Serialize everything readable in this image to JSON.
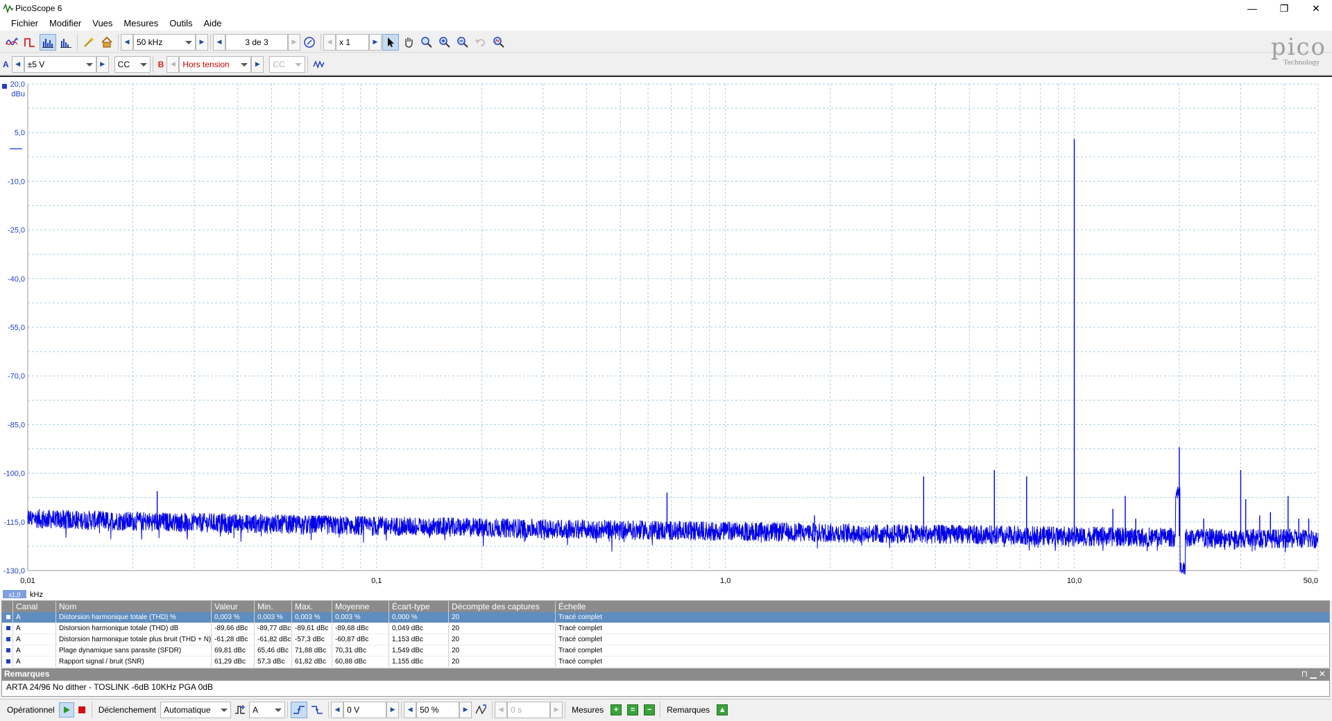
{
  "window": {
    "title": "PicoScope 6",
    "minimize": "—",
    "restore": "❐",
    "close": "✕"
  },
  "menu": [
    "Fichier",
    "Modifier",
    "Vues",
    "Mesures",
    "Outils",
    "Aide"
  ],
  "toolbar1": {
    "frequency": "50 kHz",
    "buffer": "3 de 3",
    "zoom": "x 1"
  },
  "toolbar2": {
    "chan_a": "A",
    "range_a": "±5 V",
    "coupling_a": "CC",
    "chan_b": "B",
    "range_b": "Hors tension",
    "coupling_b": "CC"
  },
  "logo": {
    "word": "pico",
    "sub": "Technology"
  },
  "spectrum": {
    "y_title": "dBu",
    "y_ticks": [
      "20,0",
      "5,0",
      "-10,0",
      "-25,0",
      "-40,0",
      "-55,0",
      "-70,0",
      "-85,0",
      "-100,0",
      "-115,0",
      "-130,0"
    ],
    "y_range": [
      -130,
      20
    ],
    "x_ticks": [
      "0,01",
      "0,1",
      "1,0",
      "10,0",
      "50,0"
    ],
    "x_range_khz": [
      0.01,
      50
    ],
    "x_scale": "log",
    "x_unit": "kHz",
    "zoom_badge": "x1,0",
    "trace_color": "#0000e6",
    "fundamental_khz": 10.0,
    "fundamental_db": 3,
    "spikes": [
      {
        "f": 0.0235,
        "db": -105.5
      },
      {
        "f": 0.68,
        "db": -106
      },
      {
        "f": 1.8,
        "db": -113
      },
      {
        "f": 3.7,
        "db": -101
      },
      {
        "f": 4.2,
        "db": -116
      },
      {
        "f": 5.9,
        "db": -99
      },
      {
        "f": 6.1,
        "db": -118
      },
      {
        "f": 7.3,
        "db": -101
      },
      {
        "f": 7.7,
        "db": -118
      },
      {
        "f": 10.0,
        "db": 3
      },
      {
        "f": 12.9,
        "db": -111
      },
      {
        "f": 14.0,
        "db": -107
      },
      {
        "f": 15.0,
        "db": -114
      },
      {
        "f": 20.0,
        "db": -92
      },
      {
        "f": 23.5,
        "db": -114
      },
      {
        "f": 30.0,
        "db": -99
      },
      {
        "f": 31.0,
        "db": -108
      },
      {
        "f": 34.0,
        "db": -113
      },
      {
        "f": 36.5,
        "db": -112
      },
      {
        "f": 41.0,
        "db": -107
      },
      {
        "f": 44.0,
        "db": -114
      },
      {
        "f": 47.0,
        "db": -114
      }
    ]
  },
  "measurements": {
    "headers": [
      "",
      "Canal",
      "Nom",
      "Valeur",
      "Min.",
      "Max.",
      "Moyenne",
      "Écart-type",
      "Décompte des captures",
      "Échelle"
    ],
    "rows": [
      [
        "A",
        "Distorsion harmonique totale (THD) %",
        "0,003 %",
        "0,003 %",
        "0,003 %",
        "0,003 %",
        "0,000 %",
        "20",
        "Tracé complet"
      ],
      [
        "A",
        "Distorsion harmonique totale (THD) dB",
        "-89,66 dBc",
        "-89,77 dBc",
        "-89,61 dBc",
        "-89,68 dBc",
        "0,049 dBc",
        "20",
        "Tracé complet"
      ],
      [
        "A",
        "Distorsion harmonique totale plus bruit (THD + N)",
        "-61,28 dBc",
        "-61,82 dBc",
        "-57,3 dBc",
        "-60,87 dBc",
        "1,153 dBc",
        "20",
        "Tracé complet"
      ],
      [
        "A",
        "Plage dynamique sans parasite (SFDR)",
        "69,81 dBc",
        "65,46 dBc",
        "71,88 dBc",
        "70,31 dBc",
        "1,549 dBc",
        "20",
        "Tracé complet"
      ],
      [
        "A",
        "Rapport signal / bruit (SNR)",
        "61,29 dBc",
        "57,3 dBc",
        "61,82 dBc",
        "60,88 dBc",
        "1,155 dBc",
        "20",
        "Tracé complet"
      ]
    ]
  },
  "notes": {
    "title": "Remarques",
    "text": "ARTA 24/96 No dither - TOSLINK -6dB 10KHz  PGA 0dB"
  },
  "status": {
    "operational": "Opérationnel",
    "trigger": "Déclenchement",
    "trigger_mode": "Automatique",
    "trigger_source": "A",
    "trigger_level": "0 V",
    "pretrigger": "50 %",
    "delay": "0 s",
    "measures": "Mesures",
    "remarks": "Remarques"
  }
}
